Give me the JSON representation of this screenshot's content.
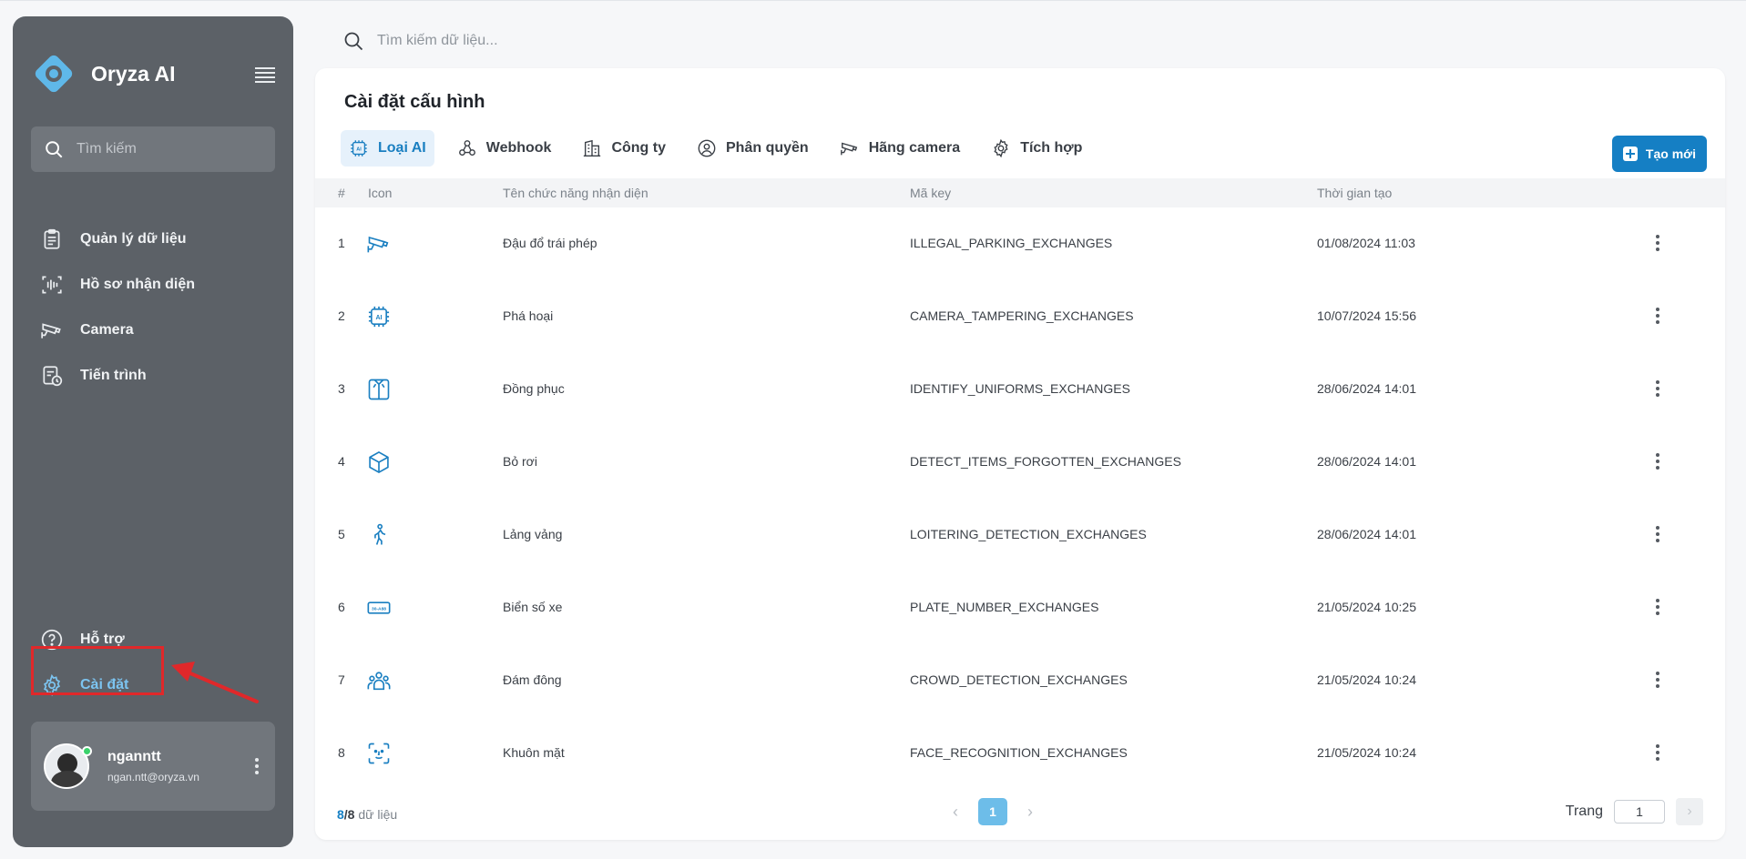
{
  "app": {
    "name": "Oryza AI"
  },
  "sidebar": {
    "search_placeholder": "Tìm kiếm",
    "items": [
      {
        "label": "Quản lý dữ liệu",
        "icon": "clipboard-list-icon"
      },
      {
        "label": "Hồ sơ nhận diện",
        "icon": "face-scan-icon"
      },
      {
        "label": "Camera",
        "icon": "cctv-camera-icon"
      },
      {
        "label": "Tiến trình",
        "icon": "report-clock-icon"
      }
    ],
    "bottom_items": [
      {
        "label": "Hỗ trợ",
        "icon": "help-circle-icon"
      },
      {
        "label": "Cài đặt",
        "icon": "gear-icon",
        "active": true
      }
    ],
    "user": {
      "name": "nganntt",
      "email": "ngan.ntt@oryza.vn"
    }
  },
  "top_search": {
    "placeholder": "Tìm kiếm dữ liệu..."
  },
  "page": {
    "title": "Cài đặt cấu hình",
    "tabs": [
      {
        "label": "Loại AI",
        "icon": "ai-chip-icon",
        "active": true
      },
      {
        "label": "Webhook",
        "icon": "webhook-icon"
      },
      {
        "label": "Công ty",
        "icon": "building-icon"
      },
      {
        "label": "Phân quyền",
        "icon": "user-group-icon"
      },
      {
        "label": "Hãng camera",
        "icon": "cctv-camera-icon"
      },
      {
        "label": "Tích hợp",
        "icon": "integration-gear-icon"
      }
    ],
    "create_button": "Tạo mới"
  },
  "table": {
    "headers": {
      "num": "#",
      "icon": "Icon",
      "name": "Tên chức năng nhận diện",
      "key": "Mã key",
      "time": "Thời gian tạo"
    },
    "rows": [
      {
        "num": "1",
        "icon": "cctv-camera-icon",
        "name": "Đậu đổ trái phép",
        "key": "ILLEGAL_PARKING_EXCHANGES",
        "time": "01/08/2024 11:03"
      },
      {
        "num": "2",
        "icon": "ai-chip-icon",
        "name": "Phá hoại",
        "key": "CAMERA_TAMPERING_EXCHANGES",
        "time": "10/07/2024 15:56"
      },
      {
        "num": "3",
        "icon": "uniform-shirt-icon",
        "name": "Đồng phục",
        "key": "IDENTIFY_UNIFORMS_EXCHANGES",
        "time": "28/06/2024 14:01"
      },
      {
        "num": "4",
        "icon": "box-icon",
        "name": "Bỏ rơi",
        "key": "DETECT_ITEMS_FORGOTTEN_EXCHANGES",
        "time": "28/06/2024 14:01"
      },
      {
        "num": "5",
        "icon": "walking-person-icon",
        "name": "Lảng vảng",
        "key": "LOITERING_DETECTION_EXCHANGES",
        "time": "28/06/2024 14:01"
      },
      {
        "num": "6",
        "icon": "license-plate-icon",
        "name": "Biển số xe",
        "key": "PLATE_NUMBER_EXCHANGES",
        "time": "21/05/2024 10:25"
      },
      {
        "num": "7",
        "icon": "crowd-icon",
        "name": "Đám đông",
        "key": "CROWD_DETECTION_EXCHANGES",
        "time": "21/05/2024 10:24"
      },
      {
        "num": "8",
        "icon": "face-scan-icon",
        "name": "Khuôn mặt",
        "key": "FACE_RECOGNITION_EXCHANGES",
        "time": "21/05/2024 10:24"
      }
    ]
  },
  "footer": {
    "shown": "8",
    "total": "/8",
    "suffix": " dữ liệu",
    "current_page": "1",
    "goto_label": "Trang",
    "goto_value": "1"
  },
  "colors": {
    "sidebar_bg": "#5c6167",
    "accent": "#157fc4",
    "active_nav": "#7cc4f0",
    "highlight": "#e0282a"
  }
}
